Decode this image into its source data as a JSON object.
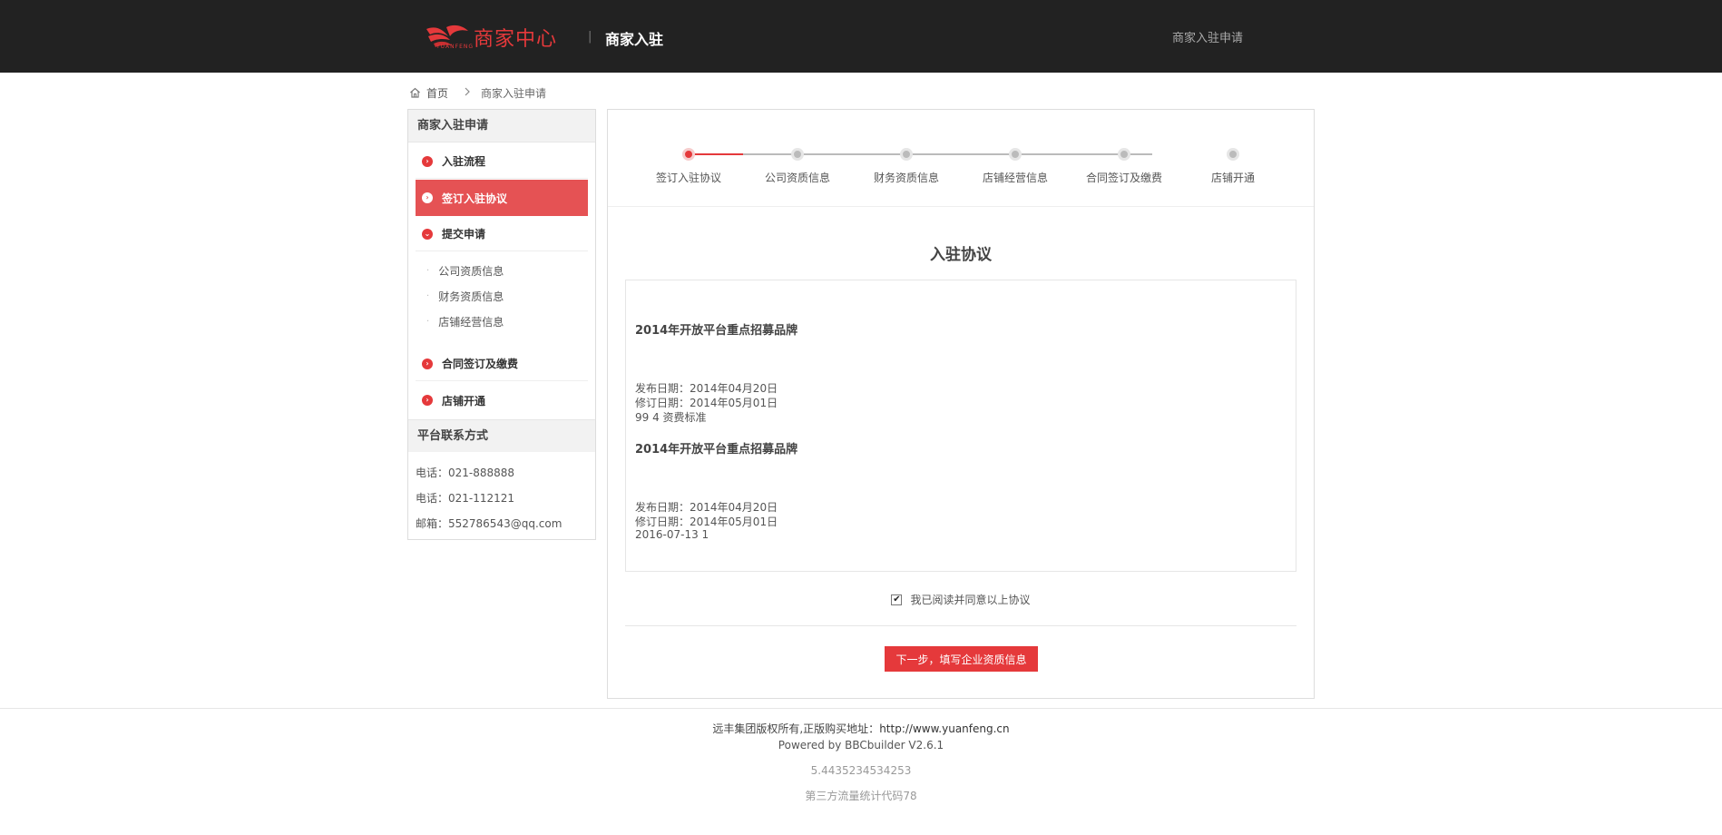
{
  "header": {
    "logo_text": "商家中心",
    "logo_sub": "YUANFENG",
    "separator": "|",
    "title": "商家入驻",
    "right_link": "商家入驻申请"
  },
  "breadcrumb": {
    "home": "首页",
    "current": "商家入驻申请"
  },
  "sidebar": {
    "heading": "商家入驻申请",
    "items": [
      {
        "label": "入驻流程",
        "icon": "chevron-right-icon"
      },
      {
        "label": "签订入驻协议",
        "icon": "chevron-right-icon",
        "active": true
      },
      {
        "label": "提交申请",
        "icon": "chevron-down-icon"
      }
    ],
    "sub_items": [
      "公司资质信息",
      "财务资质信息",
      "店铺经营信息"
    ],
    "items_after": [
      {
        "label": "合同签订及缴费",
        "icon": "chevron-right-icon"
      },
      {
        "label": "店铺开通",
        "icon": "chevron-right-icon"
      }
    ],
    "contact": {
      "heading": "平台联系方式",
      "lines": [
        "电话：021-888888",
        "电话：021-112121",
        "邮箱：552786543@qq.com"
      ]
    }
  },
  "steps": {
    "labels": [
      "签订入驻协议",
      "公司资质信息",
      "财务资质信息",
      "店铺经营信息",
      "合同签订及缴费",
      "店铺开通"
    ],
    "current_index": 0
  },
  "agreement": {
    "title": "入驻协议",
    "blocks": [
      {
        "heading": "2014年开放平台重点招募品牌",
        "lines": [
          "发布日期：2014年04月20日",
          "修订日期：2014年05月01日",
          "99 4 资费标准"
        ]
      },
      {
        "heading": "2014年开放平台重点招募品牌",
        "lines": [
          "发布日期：2014年04月20日",
          "修订日期：2014年05月01日",
          "2016-07-13 1"
        ]
      }
    ],
    "checkbox_label": "我已阅读并同意以上协议",
    "checkbox_checked": true,
    "next_button": "下一步，填写企业资质信息"
  },
  "footer": {
    "copyright": "远丰集团版权所有,正版购买地址：",
    "url": "http://www.yuanfeng.cn",
    "powered": "Powered by BBCbuilder V2.6.1",
    "number": "5.4435234534253",
    "stats": "第三方流量统计代码78"
  },
  "colors": {
    "accent": "#e5393b",
    "topbar": "#222222"
  }
}
